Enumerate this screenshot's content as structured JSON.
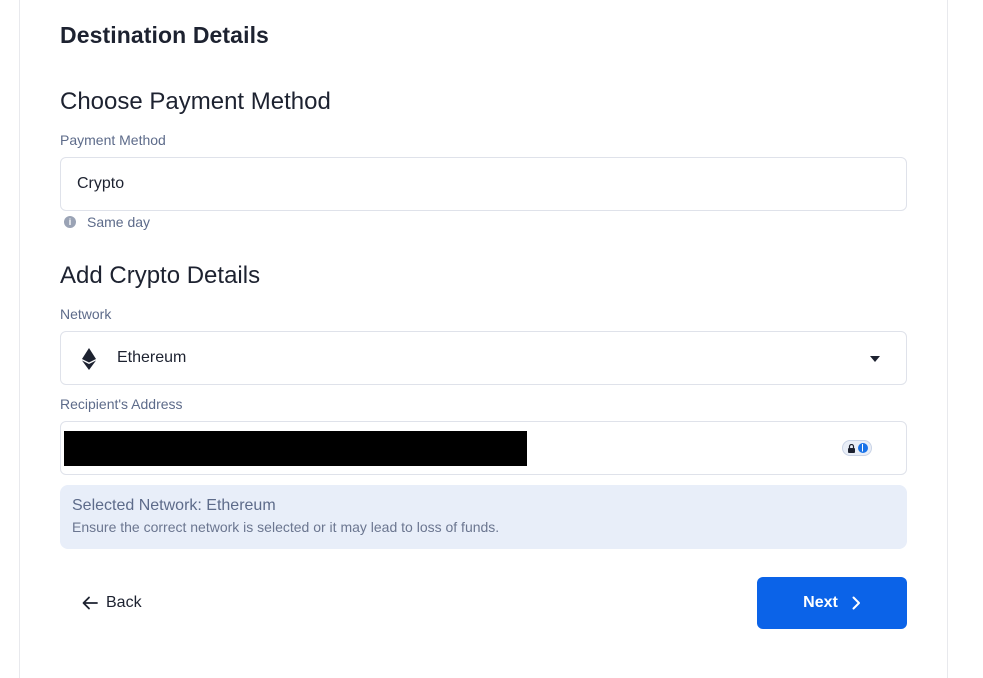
{
  "page": {
    "title": "Destination Details"
  },
  "payment": {
    "heading": "Choose Payment Method",
    "label": "Payment Method",
    "value": "Crypto",
    "hint": "Same day"
  },
  "crypto": {
    "heading": "Add Crypto Details",
    "network_label": "Network",
    "network_value": "Ethereum",
    "network_icon": "ethereum-icon",
    "address_label": "Recipient's Address"
  },
  "notice": {
    "title": "Selected Network: Ethereum",
    "text": "Ensure the correct network is selected or it may lead to loss of funds."
  },
  "actions": {
    "back_label": "Back",
    "next_label": "Next"
  },
  "colors": {
    "primary": "#0b63e8",
    "notice_bg": "#e8eef9",
    "label": "#5d6b8a"
  }
}
